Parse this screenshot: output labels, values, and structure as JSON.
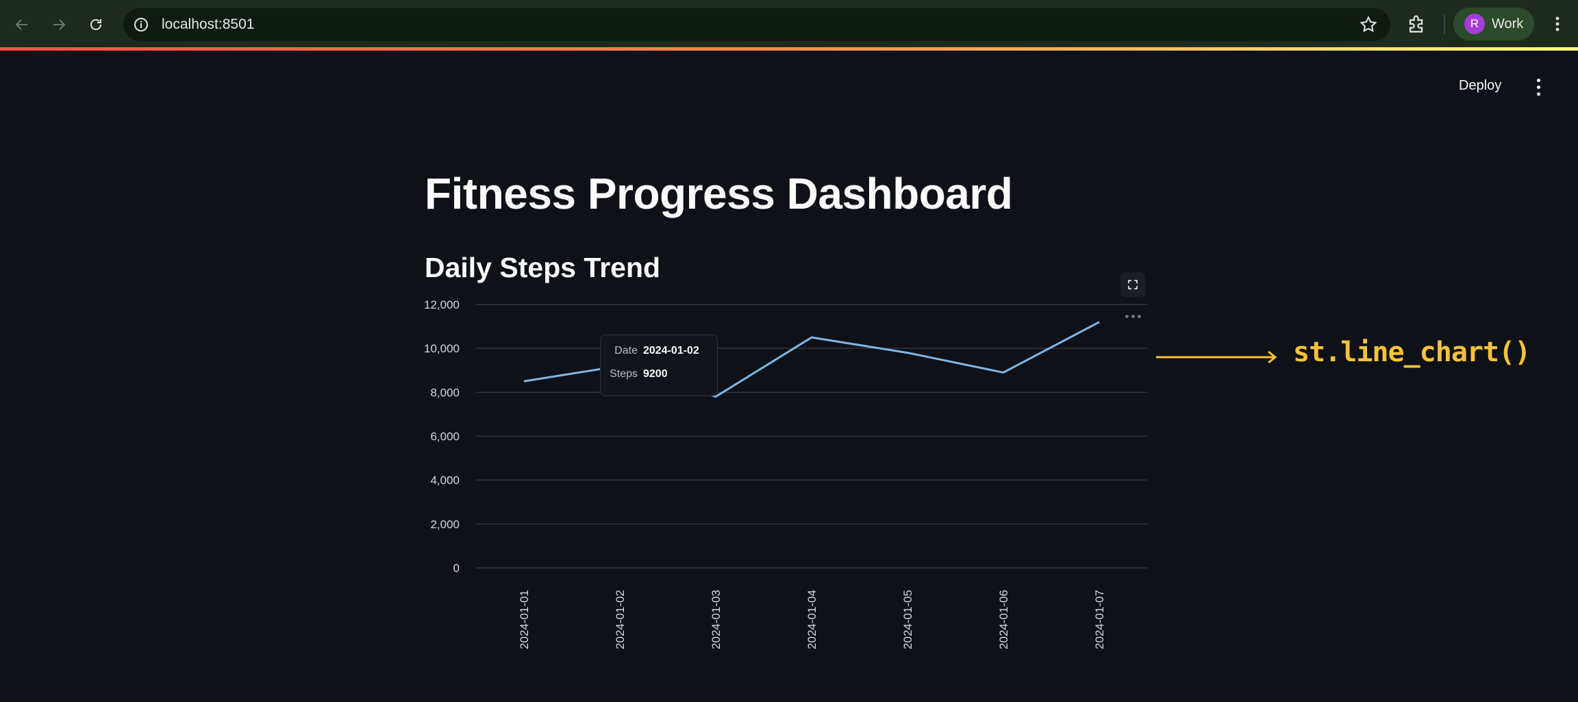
{
  "browser": {
    "url": "localhost:8501",
    "profile_initial": "R",
    "profile_name": "Work"
  },
  "app": {
    "deploy_label": "Deploy",
    "title": "Fitness Progress Dashboard",
    "subheader": "Daily Steps Trend"
  },
  "tooltip": {
    "date_key": "Date",
    "date_value": "2024-01-02",
    "steps_key": "Steps",
    "steps_value": "9200"
  },
  "annotation": {
    "text": "st.line_chart()",
    "color": "#f7c23a"
  },
  "colors": {
    "line": "#7cb8e8",
    "grid": "#31353d",
    "tick": "#d5d8dd",
    "background": "#0e1117"
  },
  "chart_data": {
    "type": "line",
    "x": [
      "2024-01-01",
      "2024-01-02",
      "2024-01-03",
      "2024-01-04",
      "2024-01-05",
      "2024-01-06",
      "2024-01-07"
    ],
    "series": [
      {
        "values": [
          8500,
          9200,
          7800,
          10500,
          9800,
          8900,
          11200
        ]
      }
    ],
    "ylim": [
      0,
      12000
    ],
    "yticks": [
      "0",
      "2,000",
      "4,000",
      "6,000",
      "8,000",
      "10,000",
      "12,000"
    ],
    "grid": true,
    "xlabel": "",
    "ylabel": ""
  }
}
